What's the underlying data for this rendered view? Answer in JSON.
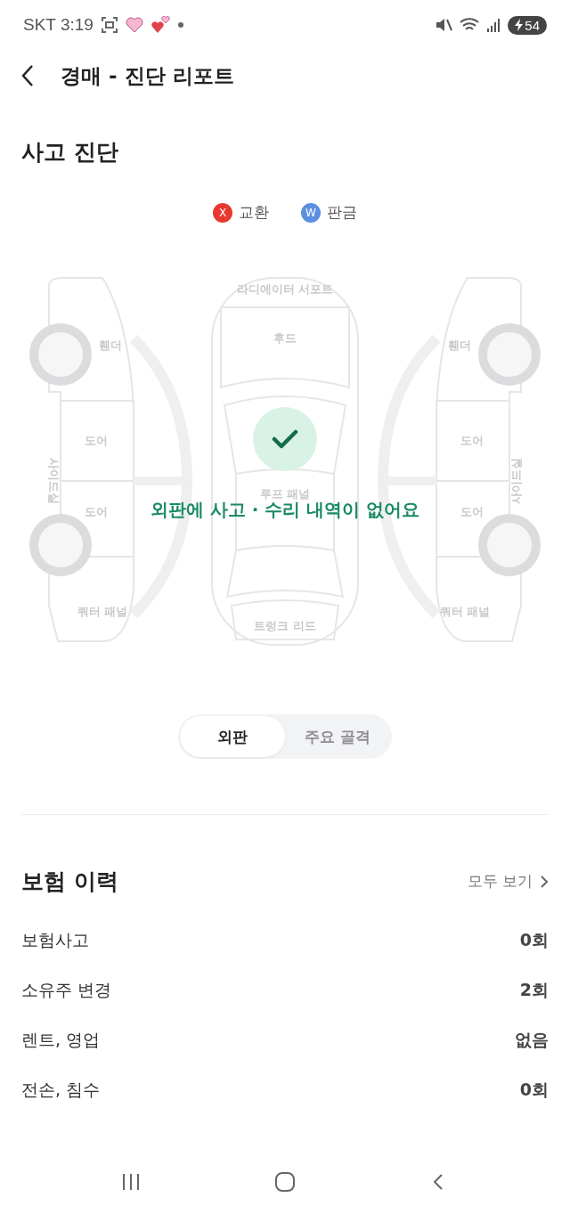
{
  "status_bar": {
    "carrier_time": "SKT 3:19",
    "battery": "54"
  },
  "header": {
    "title": "경매 - 진단 리포트"
  },
  "accident": {
    "title": "사고 진단",
    "legend": [
      {
        "symbol": "X",
        "label": "교환",
        "color": "#e8382f"
      },
      {
        "symbol": "W",
        "label": "판금",
        "color": "#5b8fe0"
      }
    ],
    "parts": [
      {
        "label": "라디에이터 서포트",
        "kind": "horizontal"
      },
      {
        "label": "후드",
        "kind": "horizontal"
      },
      {
        "label": "휀더",
        "kind": "horizontal"
      },
      {
        "label": "휀더",
        "kind": "horizontal"
      },
      {
        "label": "도어",
        "kind": "horizontal"
      },
      {
        "label": "도어",
        "kind": "horizontal"
      },
      {
        "label": "도어",
        "kind": "horizontal"
      },
      {
        "label": "도어",
        "kind": "horizontal"
      },
      {
        "label": "사이드실",
        "kind": "vertical-down"
      },
      {
        "label": "사이드실",
        "kind": "vertical-up"
      },
      {
        "label": "루프 패널",
        "kind": "horizontal"
      },
      {
        "label": "쿼터 패널",
        "kind": "horizontal"
      },
      {
        "label": "쿼터 패널",
        "kind": "horizontal"
      },
      {
        "label": "트렁크 리드",
        "kind": "horizontal"
      }
    ],
    "message": "외판에 사고 · 수리 내역이 없어요",
    "tabs": [
      {
        "label": "외판",
        "selected": true
      },
      {
        "label": "주요 골격",
        "selected": false
      }
    ]
  },
  "insurance": {
    "title": "보험 이력",
    "link": "모두 보기",
    "rows": [
      {
        "label": "보험사고",
        "value": "0회"
      },
      {
        "label": "소유주 변경",
        "value": "2회"
      },
      {
        "label": "렌트, 영업",
        "value": "없음"
      },
      {
        "label": "전손, 침수",
        "value": "0회"
      }
    ]
  }
}
